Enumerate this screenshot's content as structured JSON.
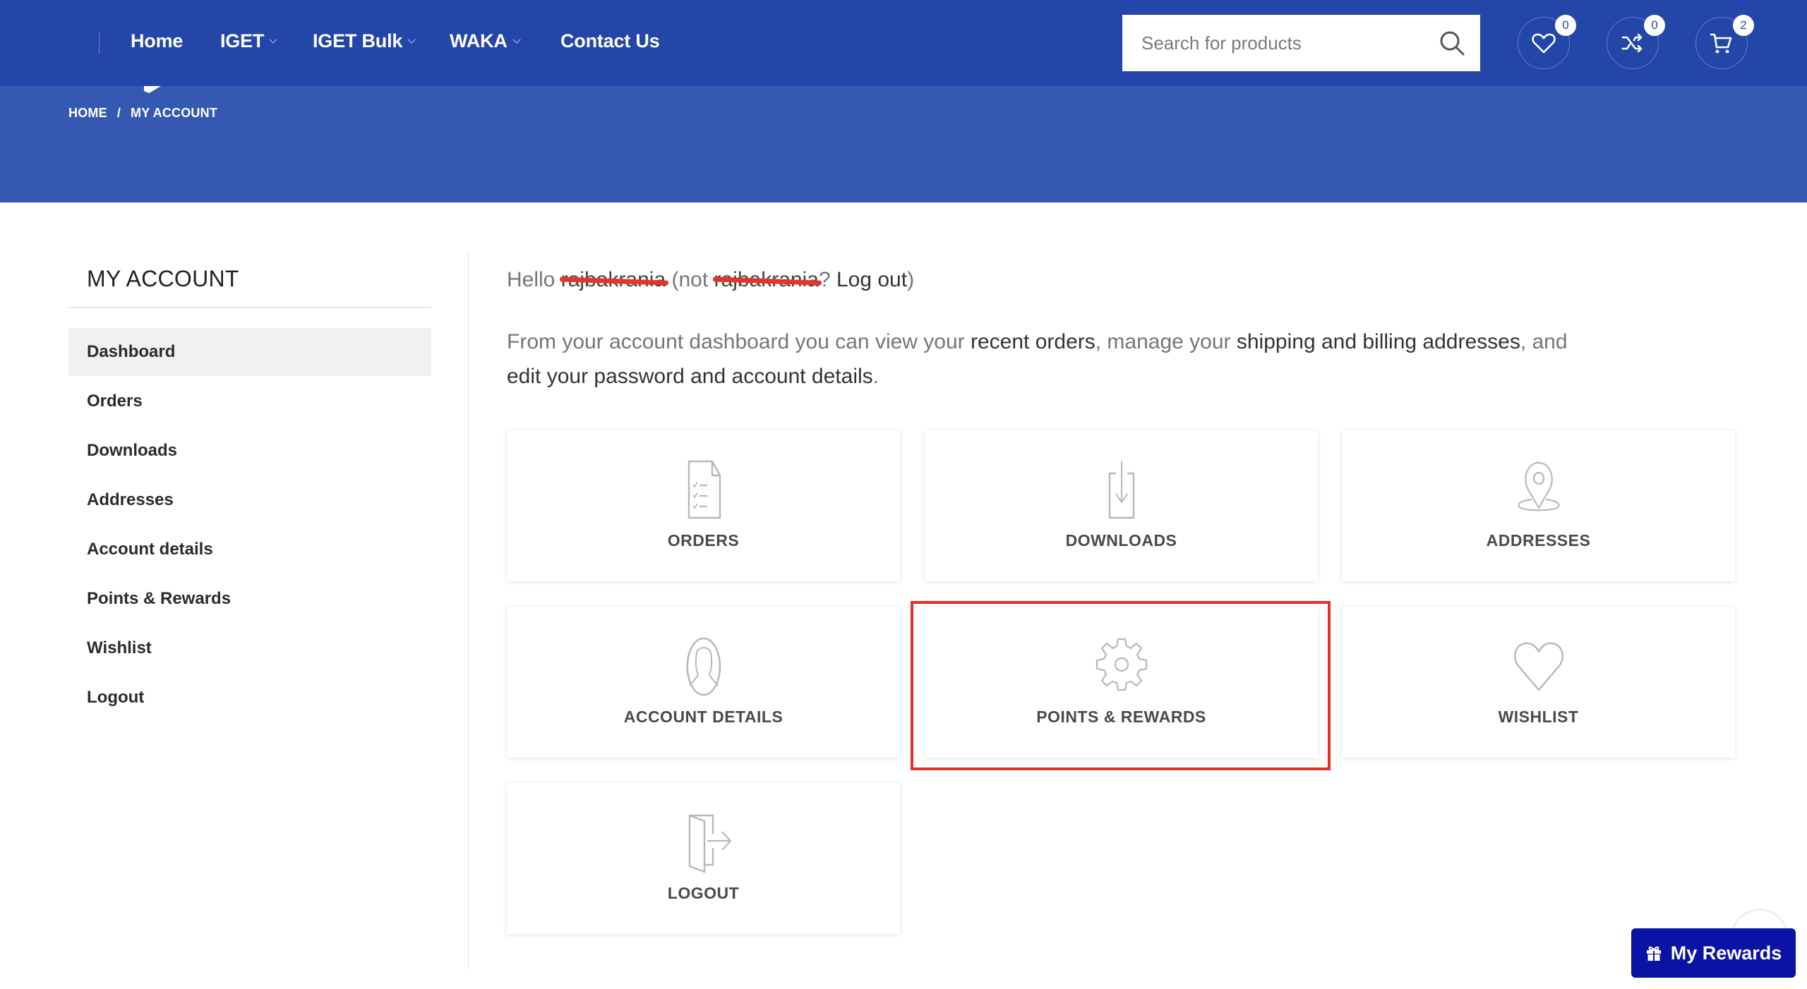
{
  "header": {
    "nav": [
      {
        "label": "Home",
        "dropdown": false
      },
      {
        "label": "IGET",
        "dropdown": true
      },
      {
        "label": "IGET Bulk",
        "dropdown": true
      },
      {
        "label": "WAKA",
        "dropdown": true
      },
      {
        "label": "Contact Us",
        "dropdown": false
      }
    ],
    "search": {
      "placeholder": "Search for products",
      "value": ""
    },
    "icons": [
      {
        "name": "wishlist-icon",
        "count": "0"
      },
      {
        "name": "compare-icon",
        "count": "0"
      },
      {
        "name": "cart-icon",
        "count": "2"
      }
    ]
  },
  "breadcrumb": {
    "home": "HOME",
    "separator": "/",
    "current": "MY ACCOUNT"
  },
  "sidebar": {
    "title": "MY ACCOUNT",
    "items": [
      {
        "label": "Dashboard",
        "active": true
      },
      {
        "label": "Orders",
        "active": false
      },
      {
        "label": "Downloads",
        "active": false
      },
      {
        "label": "Addresses",
        "active": false
      },
      {
        "label": "Account details",
        "active": false
      },
      {
        "label": "Points & Rewards",
        "active": false
      },
      {
        "label": "Wishlist",
        "active": false
      },
      {
        "label": "Logout",
        "active": false
      }
    ]
  },
  "main": {
    "hello": {
      "prefix": "Hello",
      "username": "rajbakrania",
      "not_prefix": "(not",
      "not_username": "rajbakrania",
      "question": "?",
      "logout_link": "Log out",
      "suffix": ")"
    },
    "intro": {
      "part1": "From your account dashboard you can view your ",
      "link1": "recent orders",
      "part2": ", manage your ",
      "link2": "shipping and billing addresses",
      "part3": ", and ",
      "link3": "edit your password and account details",
      "part4": "."
    },
    "tiles": [
      {
        "label": "ORDERS",
        "icon": "orders-icon"
      },
      {
        "label": "DOWNLOADS",
        "icon": "downloads-icon"
      },
      {
        "label": "ADDRESSES",
        "icon": "location-pin-icon"
      },
      {
        "label": "ACCOUNT DETAILS",
        "icon": "user-icon"
      },
      {
        "label": "POINTS & REWARDS",
        "icon": "gear-icon",
        "highlighted": true
      },
      {
        "label": "WISHLIST",
        "icon": "heart-icon"
      },
      {
        "label": "LOGOUT",
        "icon": "logout-door-icon"
      }
    ]
  },
  "floating": {
    "rewards_label": "My Rewards"
  },
  "colors": {
    "header_bg": "#2346a8",
    "banner_bg": "#3558b3",
    "rewards_bg": "#0a13a4",
    "highlight": "#e03128"
  }
}
